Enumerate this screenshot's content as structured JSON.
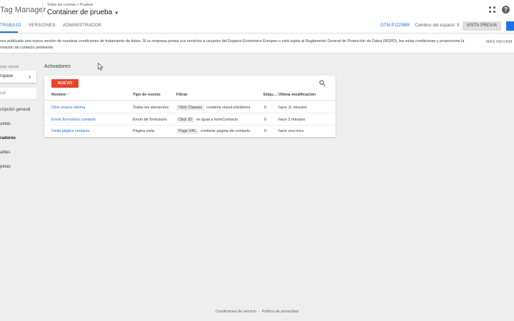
{
  "header": {
    "product": "Tag Manager",
    "breadcrumb": "Todas las cuentas > Pruebas",
    "container": "Container de prueba"
  },
  "nav": {
    "tabs": [
      {
        "label": "TRABAJO"
      },
      {
        "label": "VERSIONES"
      },
      {
        "label": "ADMINISTRADOR"
      }
    ],
    "container_id": "GTM-PJ2Z6BR",
    "workspace_changes": "Cambios del espacio: 9",
    "preview_label": "VISTA PREVIA"
  },
  "notice": {
    "text": "nos publicado una nueva versión de nuestras condiciones de tratamiento de datos. Si su empresa presta sus servicios a usuarios del Espacio Económico Europeo o está sujeta al Reglamento General de Protección de Datos (RGPD), lea estas condiciones y proporcione la rmación de contacto pertinente.",
    "more": "MÁS INFORM"
  },
  "sidebar": {
    "workspace_label": "pajo actual",
    "workspace_name": "rspace",
    "search_placeholder": "car",
    "items": [
      {
        "label": "cripción general"
      },
      {
        "label": "uetas"
      },
      {
        "label": "radores"
      },
      {
        "label": "ables"
      },
      {
        "label": "petas"
      }
    ]
  },
  "main": {
    "title": "Activadores",
    "new_button": "NUEVO",
    "columns": [
      "Nombre ↑",
      "Tipo de evento",
      "Filtrar",
      "Etiqu…",
      "Última modificación"
    ],
    "rows": [
      {
        "name": "Click enlace idioma",
        "event": "Todos los elementos",
        "filter_chip": "Click Classes",
        "filter_rest": "contiene classLinkIdioma",
        "tags": "0",
        "modified": "hace 11 minutos"
      },
      {
        "name": "Envío formulario contacto",
        "event": "Envío de formulario",
        "filter_chip": "Click ID",
        "filter_rest": "es igual a formContacto",
        "tags": "0",
        "modified": "hace 2 minutos"
      },
      {
        "name": "Visita página contacto",
        "event": "Página vista",
        "filter_chip": "Page URL",
        "filter_rest": "contiene pagina-de-contacto",
        "tags": "0",
        "modified": "hace una hora"
      }
    ]
  },
  "footer": {
    "terms": "Condiciones de servicio",
    "separator": "·",
    "privacy": "Política de privacidad"
  },
  "colors": {
    "accent": "#1a73e8",
    "new_button": "#e8452c"
  }
}
